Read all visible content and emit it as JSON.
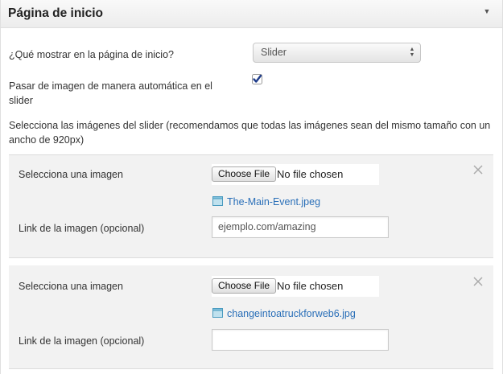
{
  "header": {
    "title": "Página de inicio"
  },
  "home_display": {
    "label": "¿Qué mostrar en la página de inicio?",
    "selected": "Slider"
  },
  "autoplay": {
    "label": "Pasar de imagen de manera automática en el slider",
    "checked": true
  },
  "slider_help": "Selecciona las imágenes del slider (recomendamos que todas las imágenes sean del mismo tamaño con un ancho de 920px)",
  "items": [
    {
      "select_label": "Selecciona una imagen",
      "button_label": "Choose File",
      "file_status": "No file chosen",
      "file_name": "The-Main-Event.jpeg",
      "link_label": "Link de la imagen (opcional)",
      "link_value": "ejemplo.com/amazing",
      "link_placeholder": ""
    },
    {
      "select_label": "Selecciona una imagen",
      "button_label": "Choose File",
      "file_status": "No file chosen",
      "file_name": "changeintoatruckforweb6.jpg",
      "link_label": "Link de la imagen (opcional)",
      "link_value": "",
      "link_placeholder": ""
    }
  ],
  "colors": {
    "link": "#2a6fb8",
    "checkbox": "#1f3c8a",
    "panel_bg": "#f2f2f2"
  },
  "icons": {
    "collapse": "chevron-down-icon",
    "remove": "close-icon",
    "file": "file-icon",
    "select": "updown-arrows-icon"
  }
}
